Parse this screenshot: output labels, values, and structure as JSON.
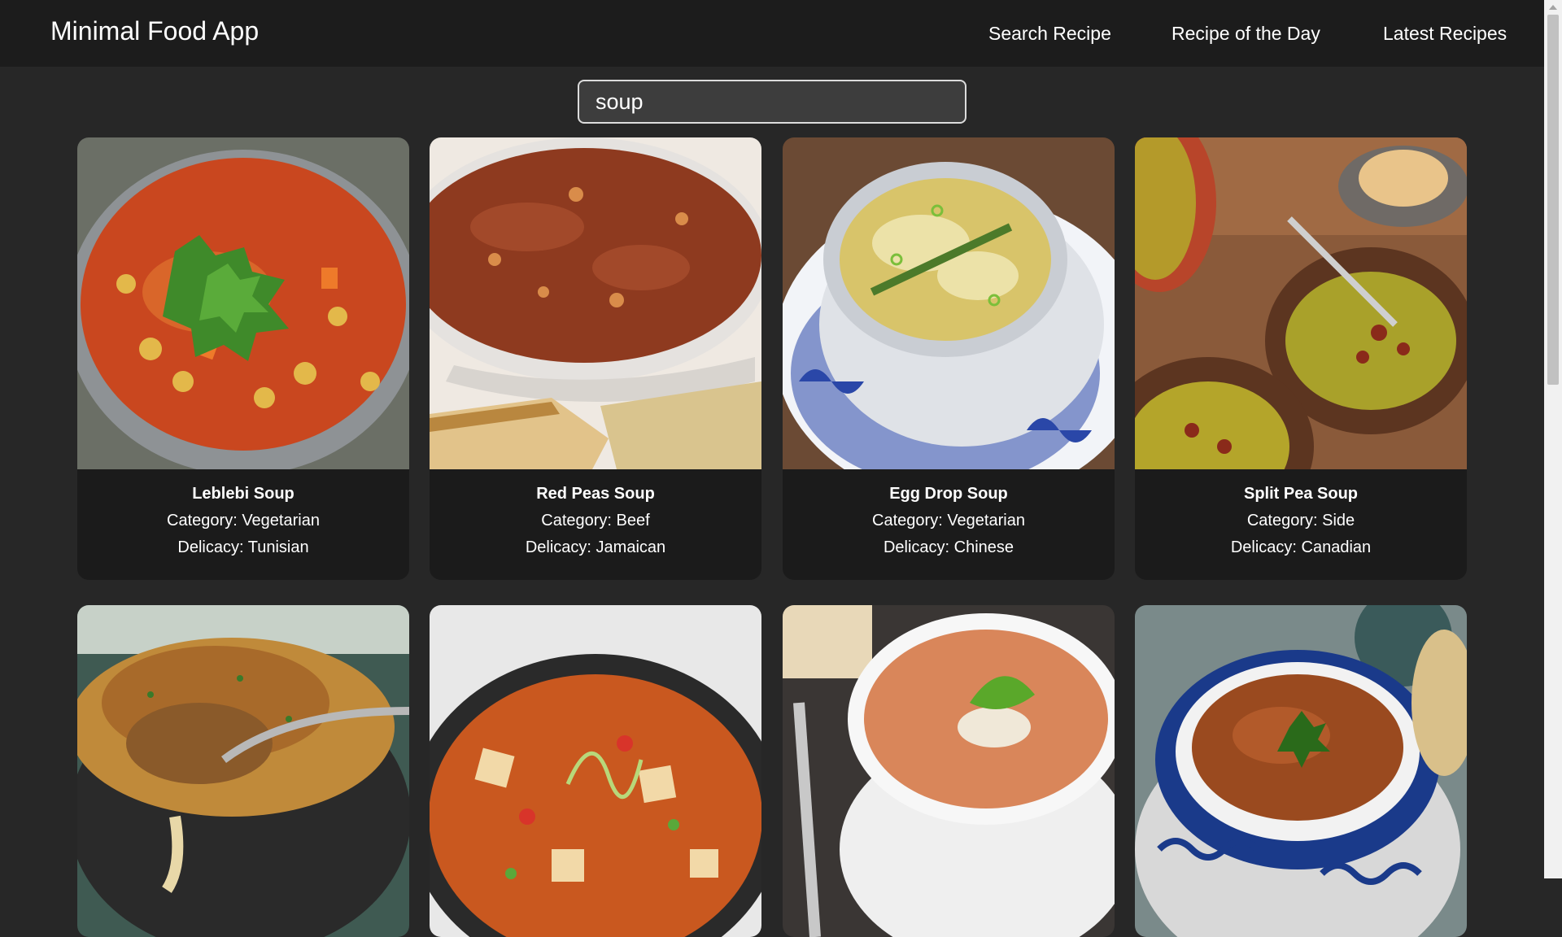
{
  "header": {
    "title": "Minimal Food App",
    "nav": [
      {
        "label": "Search Recipe"
      },
      {
        "label": "Recipe of the Day"
      },
      {
        "label": "Latest Recipes"
      }
    ]
  },
  "search": {
    "value": "soup"
  },
  "recipes": [
    {
      "name": "Leblebi Soup",
      "category": "Category: Vegetarian",
      "delicacy": "Delicacy: Tunisian",
      "image": "leblebi-soup-photo"
    },
    {
      "name": "Red Peas Soup",
      "category": "Category: Beef",
      "delicacy": "Delicacy: Jamaican",
      "image": "red-peas-soup-photo"
    },
    {
      "name": "Egg Drop Soup",
      "category": "Category: Vegetarian",
      "delicacy": "Delicacy: Chinese",
      "image": "egg-drop-soup-photo"
    },
    {
      "name": "Split Pea Soup",
      "category": "Category: Side",
      "delicacy": "Delicacy: Canadian",
      "image": "split-pea-soup-photo"
    },
    {
      "image": "french-onion-soup-photo"
    },
    {
      "image": "hot-and-sour-soup-photo"
    },
    {
      "image": "tomato-bisque-photo"
    },
    {
      "image": "harira-soup-photo"
    }
  ],
  "colors": {
    "page_bg": "#272727",
    "navbar_bg": "#1c1c1c",
    "card_bg": "#1b1b1b",
    "search_bg": "#3d3d3d",
    "text": "#ffffff"
  }
}
